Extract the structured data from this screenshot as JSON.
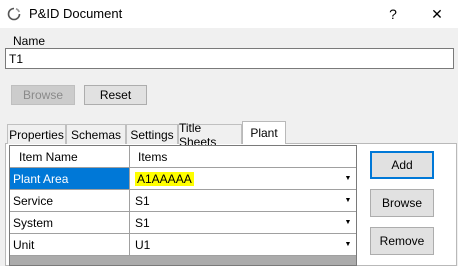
{
  "window": {
    "title": "P&ID Document",
    "help_glyph": "?",
    "close_glyph": "✕"
  },
  "name_group": {
    "label": "Name",
    "value": "T1"
  },
  "buttons": {
    "browse": "Browse",
    "reset": "Reset"
  },
  "tabs": [
    {
      "label": "Properties",
      "active": false
    },
    {
      "label": "Schemas",
      "active": false
    },
    {
      "label": "Settings",
      "active": false
    },
    {
      "label": "Title Sheets",
      "active": false
    },
    {
      "label": "Plant",
      "active": true
    }
  ],
  "grid": {
    "headers": [
      "Item Name",
      "Items"
    ],
    "rows": [
      {
        "name": "Plant Area",
        "value": "A1AAAAA",
        "selected": true
      },
      {
        "name": "Service",
        "value": "S1",
        "selected": false
      },
      {
        "name": "System",
        "value": "S1",
        "selected": false
      },
      {
        "name": "Unit",
        "value": "U1",
        "selected": false
      }
    ]
  },
  "side_buttons": {
    "add": "Add",
    "browse": "Browse",
    "remove": "Remove"
  },
  "colors": {
    "selection": "#0078d7",
    "highlight": "#ffff00",
    "default_button_border": "#0078d7"
  }
}
